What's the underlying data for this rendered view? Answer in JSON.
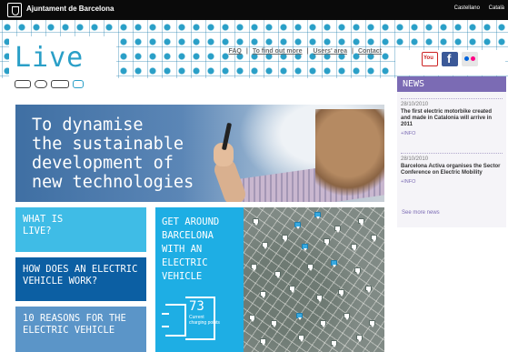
{
  "topbar": {
    "city": "Ajuntament de Barcelona",
    "languages": [
      "Castellano",
      "Català"
    ]
  },
  "logo": {
    "text": "Live"
  },
  "nav": {
    "items": [
      "FAQ",
      "To find out more",
      "Users' area",
      "Contact"
    ]
  },
  "hero": {
    "title": "To dynamise\nthe sustainable\ndevelopment of\nnew technologies"
  },
  "tiles": [
    {
      "label": "WHAT IS\nLIVE?"
    },
    {
      "label": "HOW DOES AN ELECTRIC\nVEHICLE WORK?"
    },
    {
      "label": "10 REASONS FOR THE\nELECTRIC VEHICLE"
    }
  ],
  "around": {
    "title": "GET AROUND\nBARCELONA\nWITH AN\nELECTRIC\nVEHICLE",
    "count": "73",
    "count_label": "Current charging points"
  },
  "news": {
    "heading": "NEWS",
    "items": [
      {
        "date": "28/10/2010",
        "title": "The first electric motorbike created and made in Catalonia will arrive in 2011",
        "more": "+INFO"
      },
      {
        "date": "28/10/2010",
        "title": "Barcelona Activa organises the Sector Conference on Electric Mobility",
        "more": "+INFO"
      }
    ],
    "see_more": "See more news"
  },
  "social": {
    "icons": [
      "youtube-icon",
      "facebook-icon",
      "flickr-icon"
    ]
  },
  "colors": {
    "brand_blue": "#2a9fc7",
    "tile_light": "#3fbce6",
    "tile_dark": "#0c5fa3",
    "tile_mid": "#5b95c8",
    "news_purple": "#7b6bb4"
  }
}
